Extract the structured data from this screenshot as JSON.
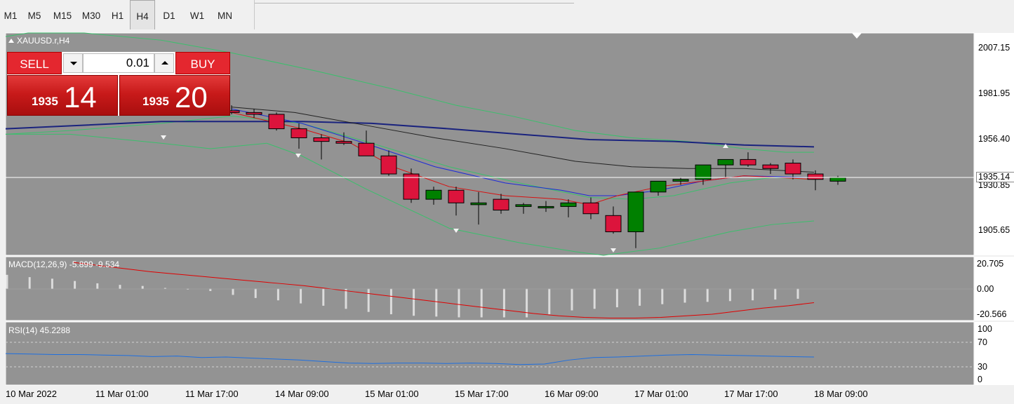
{
  "toolbar": {
    "timeframes": [
      {
        "label": "M1",
        "active": false
      },
      {
        "label": "M5",
        "active": false
      },
      {
        "label": "M15",
        "active": false
      },
      {
        "label": "M30",
        "active": false
      },
      {
        "label": "H1",
        "active": false
      },
      {
        "label": "H4",
        "active": true
      },
      {
        "label": "D1",
        "active": false
      },
      {
        "label": "W1",
        "active": false
      },
      {
        "label": "MN",
        "active": false
      }
    ]
  },
  "chart": {
    "title": "XAUUSD.r,H4",
    "price_axis": [
      "2007.15",
      "1981.95",
      "1956.40",
      "1930.85",
      "1905.65"
    ],
    "current_price_label": "1935.14",
    "time_axis": [
      "10 Mar 2022",
      "11 Mar 01:00",
      "11 Mar 17:00",
      "14 Mar 09:00",
      "15 Mar 01:00",
      "15 Mar 17:00",
      "16 Mar 09:00",
      "17 Mar 01:00",
      "17 Mar 17:00",
      "18 Mar 09:00"
    ]
  },
  "one_click_trading": {
    "sell_label": "SELL",
    "buy_label": "BUY",
    "lot_value": "0.01",
    "sell_price_prefix": "1935",
    "sell_price_main": "14",
    "buy_price_prefix": "1935",
    "buy_price_main": "20"
  },
  "macd": {
    "title": "MACD(12,26,9) -5.899 -9.534",
    "axis": [
      "20.705",
      "0.00",
      "-20.566"
    ]
  },
  "rsi": {
    "title": "RSI(14) 45.2288",
    "axis": [
      "100",
      "70",
      "30",
      "0"
    ]
  },
  "chart_data": {
    "type": "candlestick",
    "symbol": "XAUUSD.r",
    "timeframe": "H4",
    "ylim": [
      1893,
      2016
    ],
    "last_price": 1935.14,
    "candles": [
      {
        "o": 1973,
        "h": 1976,
        "l": 1971,
        "c": 1972
      },
      {
        "o": 1972,
        "h": 1974,
        "l": 1969,
        "c": 1971
      },
      {
        "o": 1971,
        "h": 1972,
        "l": 1962,
        "c": 1963
      },
      {
        "o": 1963,
        "h": 1966,
        "l": 1952,
        "c": 1958
      },
      {
        "o": 1958,
        "h": 1960,
        "l": 1946,
        "c": 1956
      },
      {
        "o": 1956,
        "h": 1961,
        "l": 1954,
        "c": 1955
      },
      {
        "o": 1955,
        "h": 1962,
        "l": 1949,
        "c": 1948
      },
      {
        "o": 1948,
        "h": 1951,
        "l": 1937,
        "c": 1938
      },
      {
        "o": 1938,
        "h": 1941,
        "l": 1922,
        "c": 1924
      },
      {
        "o": 1924,
        "h": 1931,
        "l": 1921,
        "c": 1929
      },
      {
        "o": 1929,
        "h": 1931,
        "l": 1915,
        "c": 1922
      },
      {
        "o": 1921,
        "h": 1928,
        "l": 1910,
        "c": 1922
      },
      {
        "o": 1924,
        "h": 1927,
        "l": 1916,
        "c": 1918
      },
      {
        "o": 1920,
        "h": 1922,
        "l": 1916,
        "c": 1921
      },
      {
        "o": 1920,
        "h": 1923,
        "l": 1917,
        "c": 1920
      },
      {
        "o": 1920,
        "h": 1924,
        "l": 1914,
        "c": 1922
      },
      {
        "o": 1922,
        "h": 1925,
        "l": 1913,
        "c": 1916
      },
      {
        "o": 1915,
        "h": 1920,
        "l": 1905,
        "c": 1906
      },
      {
        "o": 1906,
        "h": 1928,
        "l": 1897,
        "c": 1928
      },
      {
        "o": 1928,
        "h": 1934,
        "l": 1926,
        "c": 1934
      },
      {
        "o": 1934,
        "h": 1936,
        "l": 1932,
        "c": 1935
      },
      {
        "o": 1935,
        "h": 1943,
        "l": 1932,
        "c": 1943
      },
      {
        "o": 1943,
        "h": 1946,
        "l": 1936,
        "c": 1946
      },
      {
        "o": 1946,
        "h": 1950,
        "l": 1942,
        "c": 1943
      },
      {
        "o": 1943,
        "h": 1944,
        "l": 1938,
        "c": 1941
      },
      {
        "o": 1944,
        "h": 1946,
        "l": 1935,
        "c": 1938
      },
      {
        "o": 1938,
        "h": 1940,
        "l": 1929,
        "c": 1935
      },
      {
        "o": 1934,
        "h": 1937,
        "l": 1932,
        "c": 1936
      }
    ],
    "macd_histogram": [
      9,
      7.5,
      6.5,
      5,
      3.5,
      2.5,
      1.8,
      0.5,
      -0.5,
      -1.5,
      -4,
      -6,
      -7.5,
      -9.5,
      -11,
      -13,
      -15,
      -16.5,
      -17.5,
      -18,
      -18.5,
      -18.5,
      -18.5,
      -18.5,
      -16.5,
      -14,
      -13,
      -12,
      -11,
      -10,
      -9,
      -8.5,
      -8,
      -7.5,
      -7,
      -6.5
    ],
    "macd_signal": [
      17,
      15,
      13,
      11,
      9.5,
      8,
      6.5,
      5,
      3.5,
      2,
      0,
      -2,
      -4,
      -6,
      -8,
      -10,
      -12,
      -14,
      -16,
      -17.5,
      -18.5,
      -19,
      -19,
      -18.5,
      -17.5,
      -16.5,
      -14.5,
      -12.5,
      -11,
      -9
    ],
    "rsi": [
      52,
      51,
      50,
      50,
      49,
      48,
      46,
      47,
      44,
      45,
      43,
      41,
      39,
      36,
      33,
      32,
      33,
      33,
      32,
      33,
      32,
      30,
      31,
      39,
      44,
      45,
      47,
      49,
      50,
      49,
      48,
      47,
      46,
      45
    ]
  }
}
